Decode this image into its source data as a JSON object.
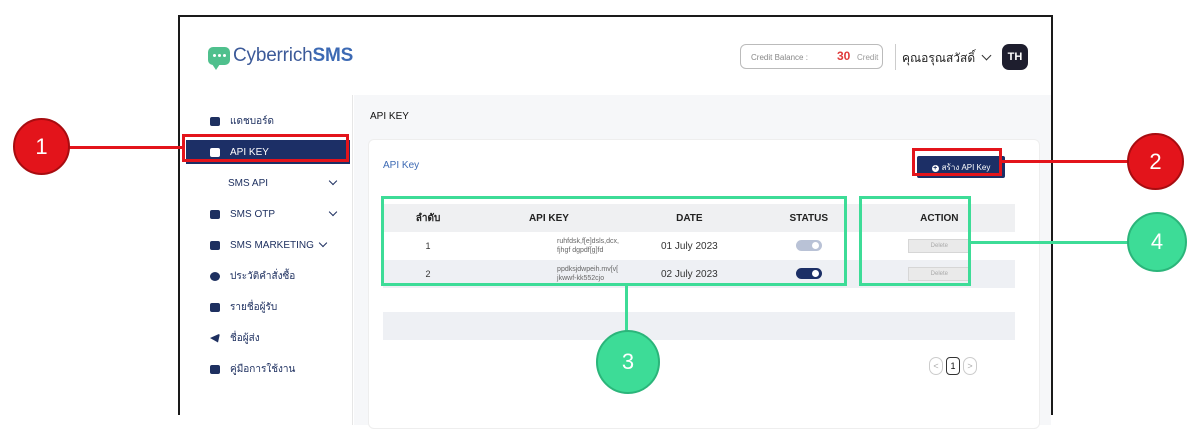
{
  "header": {
    "logo_prefix": "Cyberrich",
    "logo_suffix": "SMS",
    "credit_label": "Credit Balance :",
    "credit_value": "30",
    "credit_unit": "Credit",
    "user_name": "คุณอรุณสวัสดิ์",
    "avatar": "TH"
  },
  "sidebar": {
    "items": [
      {
        "label": "แดชบอร์ด",
        "icon": "dashboard-icon"
      },
      {
        "label": "API KEY",
        "icon": "api-icon"
      },
      {
        "label": "SMS API",
        "icon": ""
      },
      {
        "label": "SMS OTP",
        "icon": "otp-icon"
      },
      {
        "label": "SMS MARKETING",
        "icon": "marketing-icon"
      },
      {
        "label": "ประวัติคำสั่งซื้อ",
        "icon": "gear-icon"
      },
      {
        "label": "รายชื่อผู้รับ",
        "icon": "contacts-icon"
      },
      {
        "label": "ชื่อผู้ส่ง",
        "icon": "send-icon"
      },
      {
        "label": "คู่มือการใช้งาน",
        "icon": "book-icon"
      }
    ]
  },
  "main": {
    "breadcrumb": "API KEY",
    "card_title": "API Key",
    "create_button": "สร้าง API Key",
    "table": {
      "headers": [
        "ลำดับ",
        "API KEY",
        "DATE",
        "STATUS",
        "ACTION"
      ],
      "rows": [
        {
          "no": "1",
          "key_line1": "ruhfdsk,f[e]dsls,dcx,",
          "key_line2": "fjhgf dgpdf[g]fd",
          "date": "01 July 2023",
          "status": "off",
          "action": "Delete"
        },
        {
          "no": "2",
          "key_line1": "ppdksjdwpeih.mv[v[",
          "key_line2": "jkwwf-kk552cjo",
          "date": "02 July 2023",
          "status": "on",
          "action": "Delete"
        }
      ]
    },
    "pagination": {
      "current": "1",
      "prev": "<",
      "next": ">"
    }
  },
  "callouts": [
    "1",
    "2",
    "3",
    "4"
  ],
  "colors": {
    "annotation_red": "#e3141b",
    "annotation_green": "#3ddc97",
    "navy": "#1c2f66"
  }
}
